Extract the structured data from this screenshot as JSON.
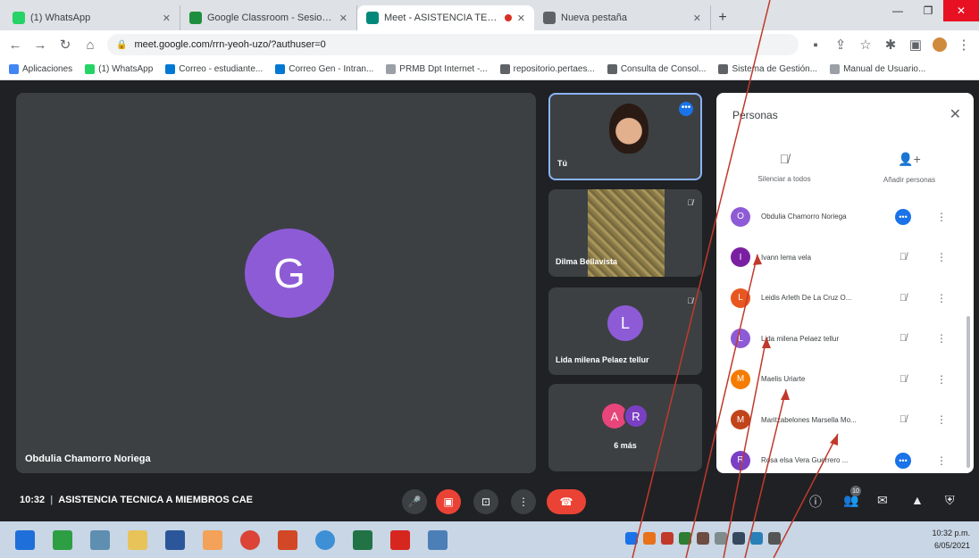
{
  "browser": {
    "tabs": [
      {
        "label": "(1) WhatsApp",
        "color": "#25d366"
      },
      {
        "label": "Google Classroom - Sesiones de...",
        "color": "#1e8e3e"
      },
      {
        "label": "Meet - ASISTENCIA TECNIC...",
        "color": "#00897b"
      },
      {
        "label": "Nueva pestaña",
        "color": "#5f6368"
      }
    ],
    "new_tab_label": "+",
    "url": "meet.google.com/rrn-yeoh-uzo/?authuser=0",
    "bookmarks": [
      {
        "label": "Aplicaciones",
        "color": "#4285f4"
      },
      {
        "label": "(1) WhatsApp",
        "color": "#25d366"
      },
      {
        "label": "Correo - estudiante...",
        "color": "#0078d4"
      },
      {
        "label": "Correo Gen - Intran...",
        "color": "#0078d4"
      },
      {
        "label": "PRMB Dpt Internet -...",
        "color": "#9aa0a6"
      },
      {
        "label": "repositorio.pertaes...",
        "color": "#5f6368"
      },
      {
        "label": "Consulta de Consol...",
        "color": "#5f6368"
      },
      {
        "label": "Sistema de Gestión...",
        "color": "#5f6368"
      },
      {
        "label": "Manual de Usuario...",
        "color": "#9aa0a6"
      }
    ]
  },
  "meet": {
    "main_tile": {
      "initial": "G",
      "name": "Obdulia Chamorro Noriega"
    },
    "side_tiles": {
      "you": {
        "name": "Tú"
      },
      "camera": {
        "name": "Dilma Bellavista"
      },
      "l_tile": {
        "initial": "L",
        "name": "Lida milena Pelaez tellur"
      },
      "more": {
        "initials": [
          "A",
          "R"
        ],
        "label": "6 más"
      }
    },
    "people_panel": {
      "title": "Personas",
      "mute_all": "Silenciar a todos",
      "add_people": "Añadir personas",
      "participants": [
        {
          "initial": "O",
          "name": "Obdulia Chamorro Noriega",
          "color": "#8e5bd6",
          "state": "more"
        },
        {
          "initial": "I",
          "name": "Ivann lema vela",
          "color": "#7b1fa2",
          "state": "muted"
        },
        {
          "initial": "L",
          "name": "Leidis Arleth De La Cruz O...",
          "color": "#e8571f",
          "state": "muted"
        },
        {
          "initial": "L",
          "name": "Lida milena Pelaez tellur",
          "color": "#8e5bd6",
          "state": "muted"
        },
        {
          "initial": "M",
          "name": "Maelis Uriarte",
          "color": "#f57c00",
          "state": "muted"
        },
        {
          "initial": "M",
          "name": "Maritzabelones Marsella Mo...",
          "color": "#c1441a",
          "state": "muted"
        },
        {
          "initial": "R",
          "name": "Rosa elsa Vera Guerrero ...",
          "color": "#7b3fc4",
          "state": "more"
        }
      ]
    },
    "bottom_bar": {
      "time": "10:32",
      "meeting_title": "ASISTENCIA TECNICA A MIEMBROS CAE",
      "people_count": "10"
    }
  },
  "taskbar": {
    "apps": [
      {
        "name": "windows-start",
        "color": "#1e6fd9"
      },
      {
        "name": "store",
        "color": "#2e9e44"
      },
      {
        "name": "app-3",
        "color": "#5e8fb0"
      },
      {
        "name": "file-explorer",
        "color": "#e8c35a"
      },
      {
        "name": "word",
        "color": "#2b579a"
      },
      {
        "name": "media",
        "color": "#f4a259"
      },
      {
        "name": "chrome",
        "color": "#db4437"
      },
      {
        "name": "powerpoint",
        "color": "#d24726"
      },
      {
        "name": "app-9",
        "color": "#3d8fd6"
      },
      {
        "name": "excel",
        "color": "#217346"
      },
      {
        "name": "acrobat",
        "color": "#d7261e"
      },
      {
        "name": "app-12",
        "color": "#4c7fb8"
      }
    ],
    "time": "10:32 p.m.",
    "date": "6/05/2021"
  }
}
